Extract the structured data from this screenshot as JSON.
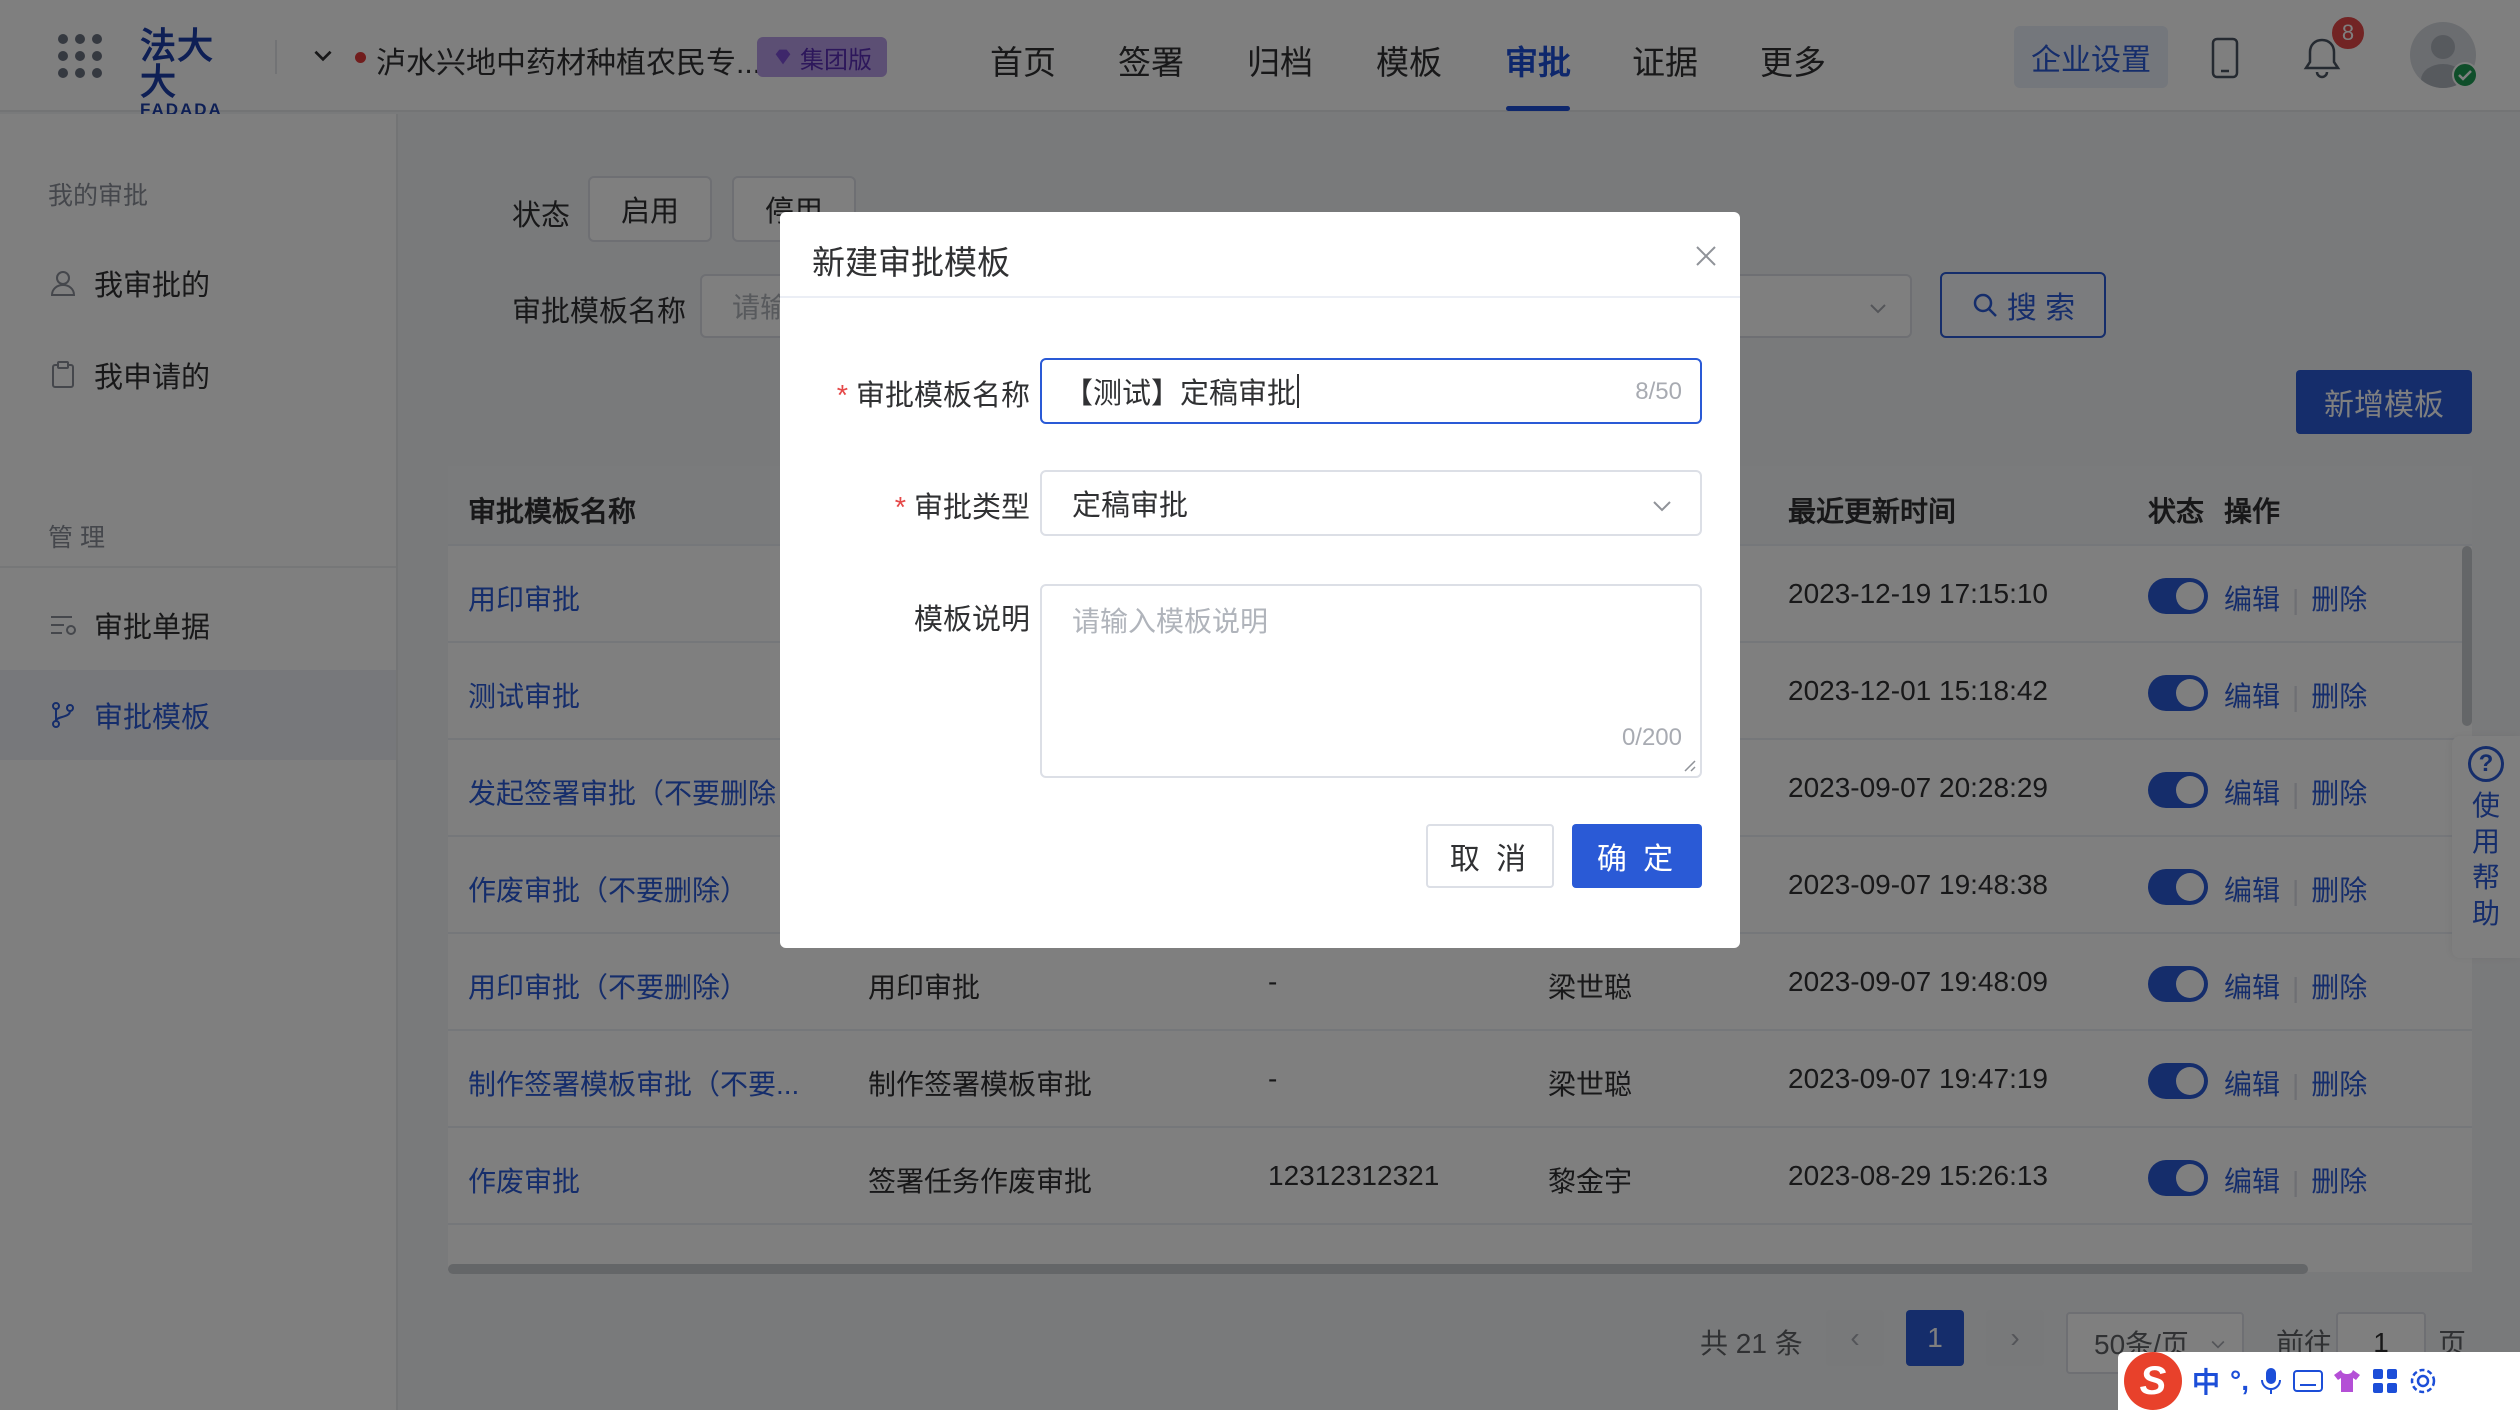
{
  "header": {
    "logo_cn": "法大大",
    "logo_en": "FADADA",
    "org_name": "泸水兴地中药材种植农民专...",
    "edition_badge": "集团版",
    "nav": [
      "首页",
      "签署",
      "归档",
      "模板",
      "审批",
      "证据",
      "更多"
    ],
    "active_nav": "审批",
    "enterprise_settings": "企业设置",
    "notification_count": "8"
  },
  "sidebar": {
    "section_mine": "我的审批",
    "item_approved_by_me": "我审批的",
    "item_applied_by_me": "我申请的",
    "section_manage": "管 理",
    "item_documents": "审批单据",
    "item_templates": "审批模板"
  },
  "filters": {
    "status_label": "状态",
    "status_enabled": "启用",
    "status_disabled": "停用",
    "name_label": "审批模板名称",
    "name_placeholder": "请输",
    "search_button": "搜 索",
    "add_button": "新增模板"
  },
  "table": {
    "headers": {
      "name": "审批模板名称",
      "updated": "最近更新时间",
      "status": "状态",
      "actions": "操作"
    },
    "rows": [
      {
        "name": "用印审批",
        "type": "",
        "desc": "",
        "updater": "",
        "updated": "2023-12-19 17:15:10"
      },
      {
        "name": "测试审批",
        "type": "",
        "desc": "",
        "updater": "",
        "updated": "2023-12-01 15:18:42"
      },
      {
        "name": "发起签署审批（不要删除",
        "type": "",
        "desc": "",
        "updater": "",
        "updated": "2023-09-07 20:28:29"
      },
      {
        "name": "作废审批（不要删除）",
        "type": "",
        "desc": "",
        "updater": "",
        "updated": "2023-09-07 19:48:38"
      },
      {
        "name": "用印审批（不要删除）",
        "type": "用印审批",
        "desc": "-",
        "updater": "梁世聪",
        "updated": "2023-09-07 19:48:09"
      },
      {
        "name": "制作签署模板审批（不要...",
        "type": "制作签署模板审批",
        "desc": "-",
        "updater": "梁世聪",
        "updated": "2023-09-07 19:47:19"
      },
      {
        "name": "作废审批",
        "type": "签署任务作废审批",
        "desc": "12312312321",
        "updater": "黎金宇",
        "updated": "2023-08-29 15:26:13"
      }
    ],
    "edit": "编辑",
    "delete": "删除"
  },
  "pagination": {
    "total": "共 21 条",
    "page": "1",
    "page_size": "50条/页",
    "goto_prefix": "前往",
    "goto_value": "1",
    "goto_suffix": "页"
  },
  "help": {
    "chars": [
      "使",
      "用",
      "帮",
      "助"
    ]
  },
  "dialog": {
    "title": "新建审批模板",
    "name_label": "审批模板名称",
    "name_value": "【测试】定稿审批",
    "name_count": "8/50",
    "type_label": "审批类型",
    "type_value": "定稿审批",
    "desc_label": "模板说明",
    "desc_placeholder": "请输入模板说明",
    "desc_count": "0/200",
    "cancel": "取 消",
    "confirm": "确 定"
  },
  "ime": {
    "lang": "中",
    "punct": "°,"
  },
  "colors": {
    "primary": "#2a5ad6",
    "danger": "#e54848",
    "badge": "#b99ee8"
  }
}
